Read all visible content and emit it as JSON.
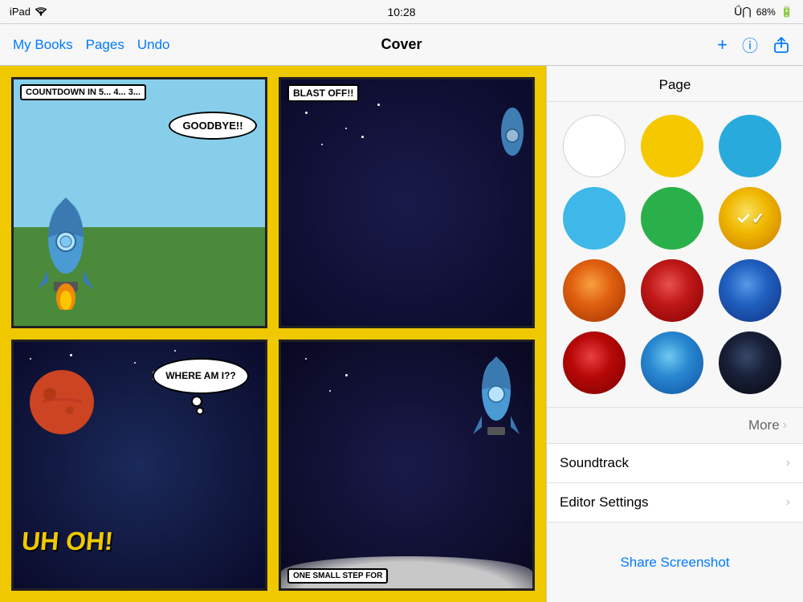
{
  "statusBar": {
    "device": "iPad",
    "wifi": "wifi",
    "time": "10:28",
    "bluetooth": "BT",
    "battery": "68%"
  },
  "navBar": {
    "myBooksLabel": "My Books",
    "pagesLabel": "Pages",
    "undoLabel": "Undo",
    "title": "Cover"
  },
  "comic": {
    "panel1Label": "COUNTDOWN IN 5... 4... 3...",
    "panel1Speech": "GOODBYE!!",
    "panel2Label": "BLAST OFF!!",
    "panel3UhOh": "UH OH!",
    "panel3Speech": "WHERE AM I??",
    "panel4Label": "ONE SMALL STEP FOR"
  },
  "rightPanel": {
    "title": "Page",
    "moreLabel": "More",
    "soundtrackLabel": "Soundtrack",
    "editorSettingsLabel": "Editor Settings",
    "shareScreenshotLabel": "Share Screenshot",
    "swatches": [
      {
        "id": "white",
        "label": "White",
        "class": "swatch-white",
        "selected": false
      },
      {
        "id": "yellow",
        "label": "Yellow",
        "class": "swatch-yellow",
        "selected": false
      },
      {
        "id": "blue",
        "label": "Blue",
        "class": "swatch-blue",
        "selected": false
      },
      {
        "id": "cyan",
        "label": "Cyan",
        "class": "swatch-cyan",
        "selected": false
      },
      {
        "id": "green",
        "label": "Green",
        "class": "swatch-green",
        "selected": false
      },
      {
        "id": "yellow2",
        "label": "Yellow2",
        "class": "swatch-yellow2",
        "selected": true
      },
      {
        "id": "orange",
        "label": "Orange",
        "class": "swatch-orange",
        "selected": false
      },
      {
        "id": "red",
        "label": "Red",
        "class": "swatch-red",
        "selected": false
      },
      {
        "id": "blue2",
        "label": "Blue2",
        "class": "swatch-blue2",
        "selected": false
      },
      {
        "id": "red2",
        "label": "Red2",
        "class": "swatch-red2",
        "selected": false
      },
      {
        "id": "lightblue",
        "label": "LightBlue",
        "class": "swatch-lightblue",
        "selected": false
      },
      {
        "id": "darkblue",
        "label": "DarkBlue",
        "class": "swatch-darkblue",
        "selected": false
      }
    ]
  }
}
